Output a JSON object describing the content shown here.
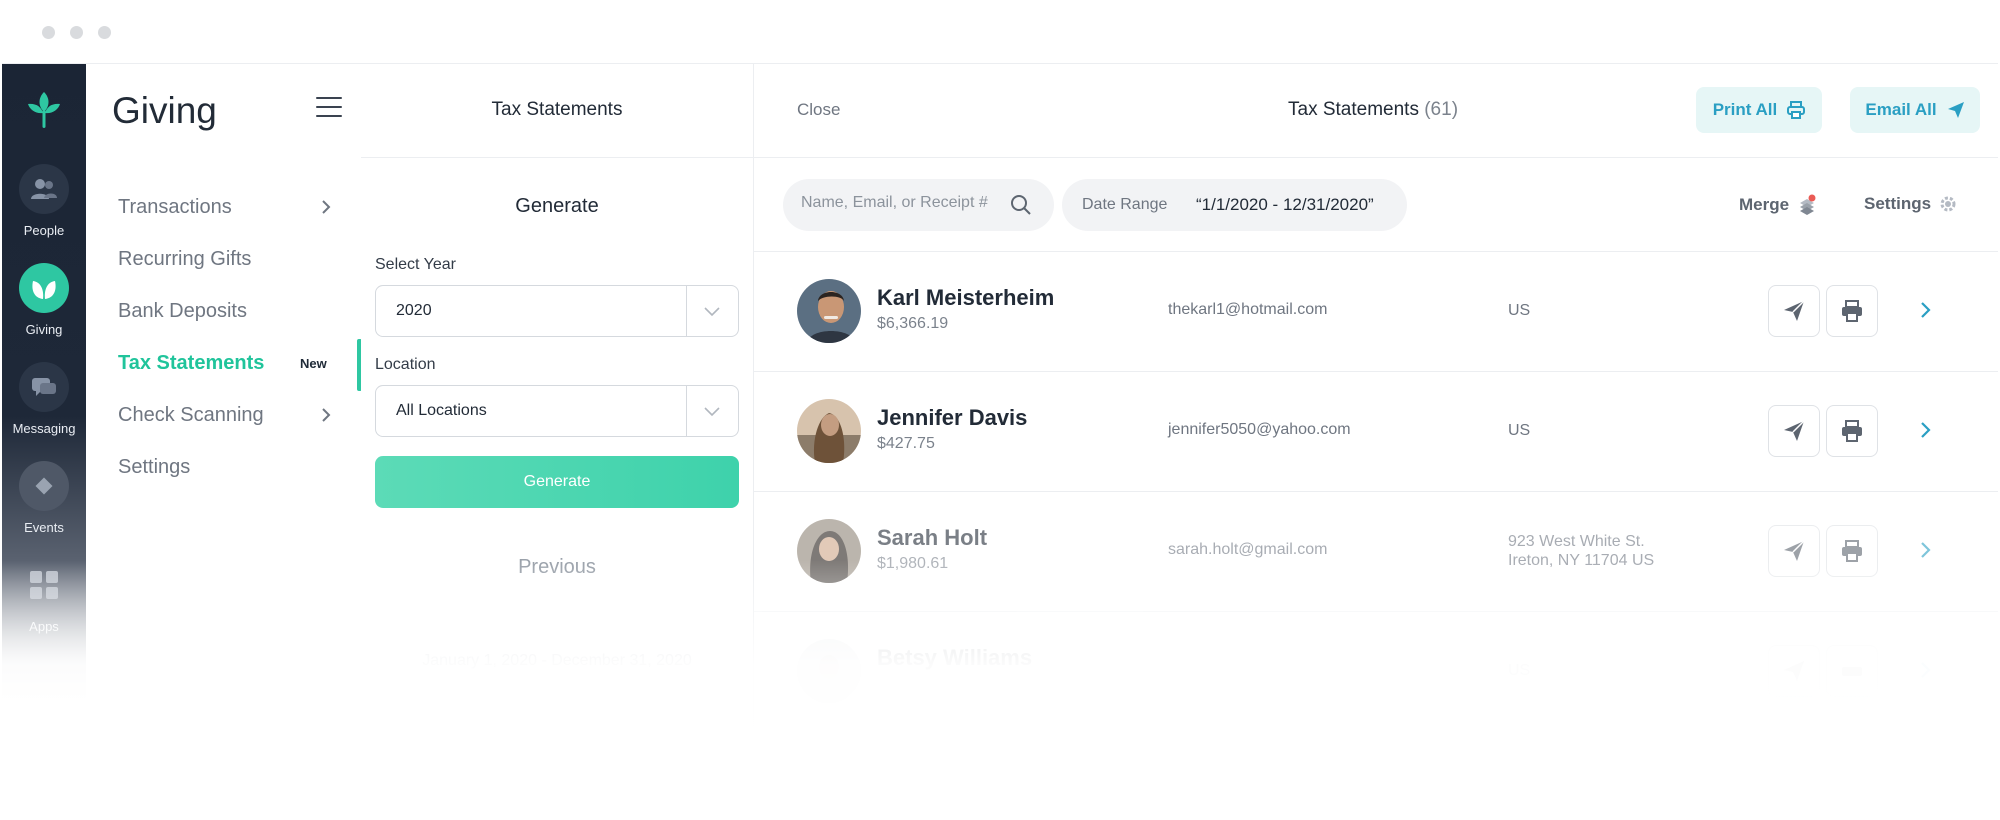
{
  "rail": {
    "items": [
      {
        "label": "People",
        "icon": "people-icon"
      },
      {
        "label": "Giving",
        "icon": "giving-icon"
      },
      {
        "label": "Messaging",
        "icon": "messaging-icon"
      },
      {
        "label": "Events",
        "icon": "events-icon"
      },
      {
        "label": "Apps",
        "icon": "apps-icon"
      }
    ]
  },
  "nav": {
    "title": "Giving",
    "items": [
      {
        "label": "Transactions"
      },
      {
        "label": "Recurring Gifts"
      },
      {
        "label": "Bank Deposits"
      },
      {
        "label": "Tax Statements",
        "badge": "New"
      },
      {
        "label": "Check Scanning"
      },
      {
        "label": "Settings"
      }
    ]
  },
  "generate": {
    "header_title": "Tax Statements",
    "subtitle": "Generate",
    "year_label": "Select Year",
    "year_value": "2020",
    "location_label": "Location",
    "location_value": "All Locations",
    "button_label": "Generate",
    "previous_label": "Previous",
    "previous_range": "January 1, 2020 - December 31, 2020"
  },
  "main": {
    "close_label": "Close",
    "title": "Tax Statements",
    "count": "(61)",
    "print_all_label": "Print All",
    "email_all_label": "Email All",
    "search_placeholder": "Name, Email, or Receipt #",
    "date_range_label": "Date Range",
    "date_range_value": "“1/1/2020 - 12/31/2020”",
    "merge_label": "Merge",
    "settings_label": "Settings",
    "rows": [
      {
        "name": "Karl Meisterheim",
        "amount": "$6,366.19",
        "email": "thekarl1@hotmail.com",
        "address_line1": "US",
        "address_line2": ""
      },
      {
        "name": "Jennifer Davis",
        "amount": "$427.75",
        "email": "jennifer5050@yahoo.com",
        "address_line1": "US",
        "address_line2": ""
      },
      {
        "name": "Sarah Holt",
        "amount": "$1,980.61",
        "email": "sarah.holt@gmail.com",
        "address_line1": "923 West White St.",
        "address_line2": "Ireton, NY 11704 US"
      },
      {
        "name": "Betsy Williams",
        "amount": "",
        "email": "",
        "address_line1": "US",
        "address_line2": ""
      }
    ]
  },
  "colors": {
    "accent": "#2ec7a2",
    "rail_bg": "#1b2535",
    "action_blue": "#2a9fc3"
  }
}
